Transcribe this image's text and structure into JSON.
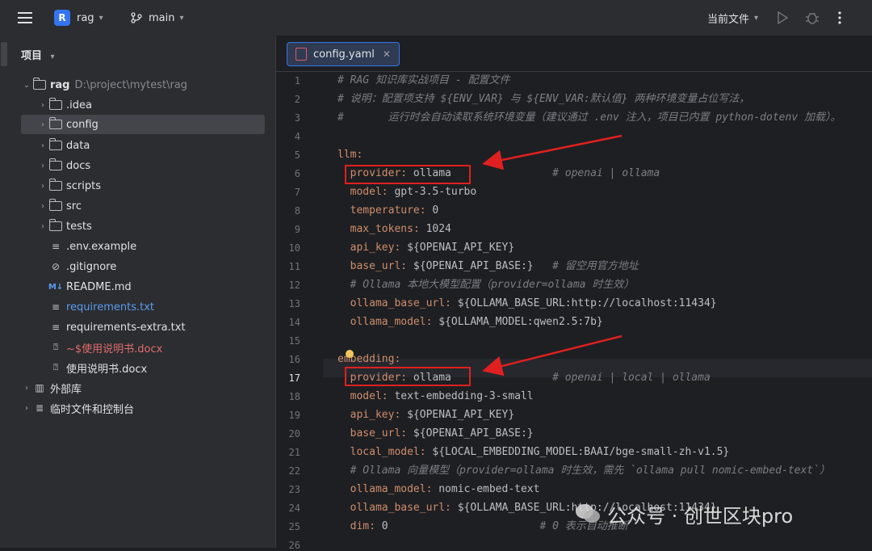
{
  "titlebar": {
    "project_letter": "R",
    "project_name": "rag",
    "branch": "main",
    "run_config": "当前文件"
  },
  "sidebar": {
    "title": "项目",
    "root": {
      "name": "rag",
      "path": "D:\\project\\mytest\\rag"
    },
    "items": [
      {
        "name": ".idea",
        "type": "folder"
      },
      {
        "name": "config",
        "type": "folder"
      },
      {
        "name": "data",
        "type": "folder"
      },
      {
        "name": "docs",
        "type": "folder"
      },
      {
        "name": "scripts",
        "type": "folder"
      },
      {
        "name": "src",
        "type": "folder"
      },
      {
        "name": "tests",
        "type": "folder"
      },
      {
        "name": ".env.example",
        "type": "text"
      },
      {
        "name": ".gitignore",
        "type": "ignore"
      },
      {
        "name": "README.md",
        "type": "markdown"
      },
      {
        "name": "requirements.txt",
        "type": "text"
      },
      {
        "name": "requirements-extra.txt",
        "type": "text"
      },
      {
        "name": "~$使用说明书.docx",
        "type": "unknown"
      },
      {
        "name": "使用说明书.docx",
        "type": "unknown"
      }
    ],
    "external_libs": "外部库",
    "scratches": "临时文件和控制台"
  },
  "editor": {
    "tab_label": "config.yaml",
    "current_line": 17,
    "lines": [
      {
        "n": "1",
        "comment": "# RAG 知识库实战项目 - 配置文件"
      },
      {
        "n": "2",
        "comment": "# 说明：配置项支持 ${ENV_VAR} 与 ${ENV_VAR:默认值} 两种环境变量占位写法，"
      },
      {
        "n": "3",
        "comment": "#       运行时会自动读取系统环境变量（建议通过 .env 注入，项目已内置 python-dotenv 加载）。"
      },
      {
        "n": "4"
      },
      {
        "n": "5",
        "key": "llm:"
      },
      {
        "n": "6",
        "key": "  provider:",
        "value": " ollama",
        "comment": "                # openai | ollama"
      },
      {
        "n": "7",
        "key": "  model:",
        "value": " gpt-3.5-turbo"
      },
      {
        "n": "8",
        "key": "  temperature:",
        "value": " 0"
      },
      {
        "n": "9",
        "key": "  max_tokens:",
        "value": " 1024"
      },
      {
        "n": "10",
        "key": "  api_key:",
        "value": " ${OPENAI_API_KEY}"
      },
      {
        "n": "11",
        "key": "  base_url:",
        "value": " ${OPENAI_API_BASE:}",
        "comment": "   # 留空用官方地址"
      },
      {
        "n": "12",
        "comment": "  # Ollama 本地大模型配置（provider=ollama 时生效）"
      },
      {
        "n": "13",
        "key": "  ollama_base_url:",
        "value": " ${OLLAMA_BASE_URL:http://localhost:11434}"
      },
      {
        "n": "14",
        "key": "  ollama_model:",
        "value": " ${OLLAMA_MODEL:qwen2.5:7b}"
      },
      {
        "n": "15"
      },
      {
        "n": "16",
        "key": "embedding:"
      },
      {
        "n": "17",
        "key": "  provider:",
        "value": " ollama",
        "comment": "                # openai | local | ollama"
      },
      {
        "n": "18",
        "key": "  model:",
        "value": " text-embedding-3-small"
      },
      {
        "n": "19",
        "key": "  api_key:",
        "value": " ${OPENAI_API_KEY}"
      },
      {
        "n": "20",
        "key": "  base_url:",
        "value": " ${OPENAI_API_BASE:}"
      },
      {
        "n": "21",
        "key": "  local_model:",
        "value": " ${LOCAL_EMBEDDING_MODEL:BAAI/bge-small-zh-v1.5}"
      },
      {
        "n": "22",
        "comment": "  # Ollama 向量模型（provider=ollama 时生效，需先 `ollama pull nomic-embed-text`）"
      },
      {
        "n": "23",
        "key": "  ollama_model:",
        "value": " nomic-embed-text"
      },
      {
        "n": "24",
        "key": "  ollama_base_url:",
        "value": " ${OLLAMA_BASE_URL:http://localhost:11434}"
      },
      {
        "n": "25",
        "key": "  dim:",
        "value": " 0",
        "comment": "                        # 0 表示自动推断"
      },
      {
        "n": "26"
      }
    ]
  },
  "watermark": "公众号 · 创世区块pro",
  "colors": {
    "accent": "#3574f0",
    "annotation": "#e02020",
    "keyword": "#cf8e6d",
    "comment": "#7a7e85"
  }
}
